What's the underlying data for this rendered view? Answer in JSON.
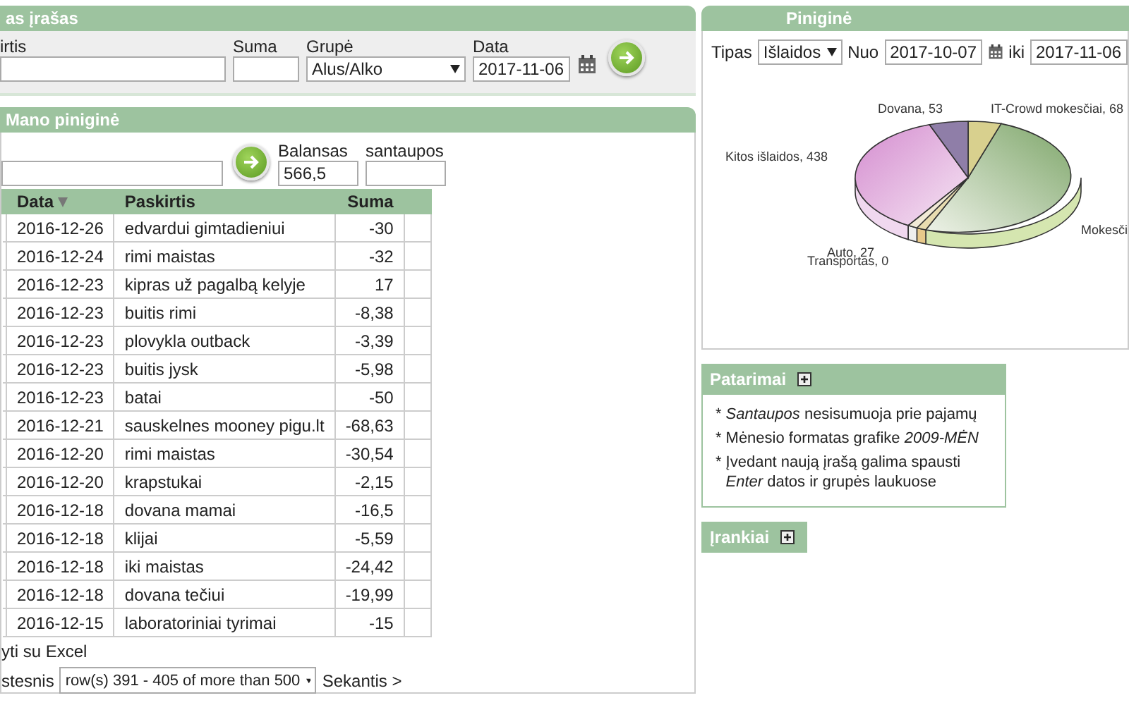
{
  "entry_panel": {
    "title": "as įrašas",
    "purpose_label": "irtis",
    "amount_label": "Suma",
    "group_label": "Grupė",
    "group": "Alus/Alko",
    "date_label": "Data",
    "date": "2017-11-06"
  },
  "wallet_panel": {
    "title": "Mano piniginė",
    "balance_label": "Balansas",
    "balance": "566,5",
    "savings_label": "santaupos",
    "table": {
      "columns": [
        {
          "label": "Data",
          "sorted": true
        },
        {
          "label": "Paskirtis",
          "sorted": false
        },
        {
          "label": "Suma",
          "sorted": false
        }
      ],
      "rows": [
        [
          "2016-12-26",
          "edvardui gimtadieniui",
          "-30"
        ],
        [
          "2016-12-24",
          "rimi maistas",
          "-32"
        ],
        [
          "2016-12-23",
          "kipras už pagalbą kelyje",
          "17"
        ],
        [
          "2016-12-23",
          "buitis rimi",
          "-8,38"
        ],
        [
          "2016-12-23",
          "plovykla outback",
          "-3,39"
        ],
        [
          "2016-12-23",
          "buitis jysk",
          "-5,98"
        ],
        [
          "2016-12-23",
          "batai",
          "-50"
        ],
        [
          "2016-12-21",
          "sauskelnes mooney pigu.lt",
          "-68,63"
        ],
        [
          "2016-12-20",
          "rimi maistas",
          "-30,54"
        ],
        [
          "2016-12-20",
          "krapstukai",
          "-2,15"
        ],
        [
          "2016-12-18",
          "dovana mamai",
          "-16,5"
        ],
        [
          "2016-12-18",
          "klijai",
          "-5,59"
        ],
        [
          "2016-12-18",
          "iki maistas",
          "-24,42"
        ],
        [
          "2016-12-18",
          "dovana tečiui",
          "-19,99"
        ],
        [
          "2016-12-15",
          "laboratoriniai tyrimai",
          "-15"
        ]
      ]
    },
    "export_link": "yti su Excel",
    "prev_link": "stesnis",
    "range": "row(s) 391 - 405 of more than 500",
    "next_link": "Sekantis >"
  },
  "chart_panel": {
    "title": "Piniginė",
    "type_label": "Tipas",
    "type": "Išlaidos",
    "from_label": "Nuo",
    "from": "2017-10-07",
    "to_label": "iki",
    "to": "2017-11-06",
    "pie_labels": [
      {
        "text": "Dovana, 53"
      },
      {
        "text": "IT-Crowd mokesčiai, 68"
      },
      {
        "text": "Kitos išlaidos, 438"
      },
      {
        "text": "Mokesči"
      },
      {
        "text": "Auto, 27"
      },
      {
        "text": "Transportas, 0"
      }
    ]
  },
  "tips_panel": {
    "title": "Patarimai",
    "bullet": "*",
    "items": [
      "*Santaupos* nesisumuoja prie pajamų",
      "Mėnesio formatas grafike *2009-MĖN*",
      "Įvedant naują įrašą galima spausti *Enter* datos ir grupės laukuose"
    ]
  },
  "tools_panel": {
    "title": "Įrankiai"
  }
}
